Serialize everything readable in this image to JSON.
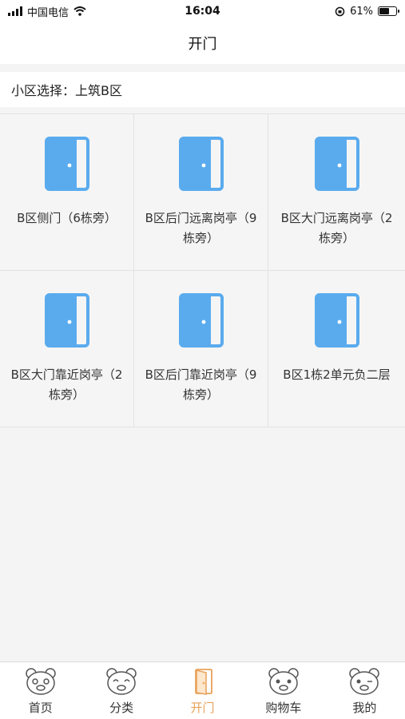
{
  "status_bar": {
    "carrier": "中国电信",
    "time": "16:04",
    "battery_percent": "61%",
    "battery_level": 0.61
  },
  "header": {
    "title": "开门"
  },
  "community": {
    "label": "小区选择：",
    "value": "上筑B区"
  },
  "doors": [
    {
      "label": "B区侧门（6栋旁）"
    },
    {
      "label": "B区后门远离岗亭（9栋旁）"
    },
    {
      "label": "B区大门远离岗亭（2栋旁）"
    },
    {
      "label": "B区大门靠近岗亭（2栋旁）"
    },
    {
      "label": "B区后门靠近岗亭（9栋旁）"
    },
    {
      "label": "B区1栋2单元负二层"
    }
  ],
  "tabs": [
    {
      "label": "首页",
      "icon": "bear-face-icon",
      "active": false
    },
    {
      "label": "分类",
      "icon": "bear-face-icon",
      "active": false
    },
    {
      "label": "开门",
      "icon": "door-icon",
      "active": true
    },
    {
      "label": "购物车",
      "icon": "bear-face-icon",
      "active": false
    },
    {
      "label": "我的",
      "icon": "bear-face-icon",
      "active": false
    }
  ],
  "colors": {
    "door_blue": "#5aabee",
    "active_tab": "#e8a25a"
  }
}
